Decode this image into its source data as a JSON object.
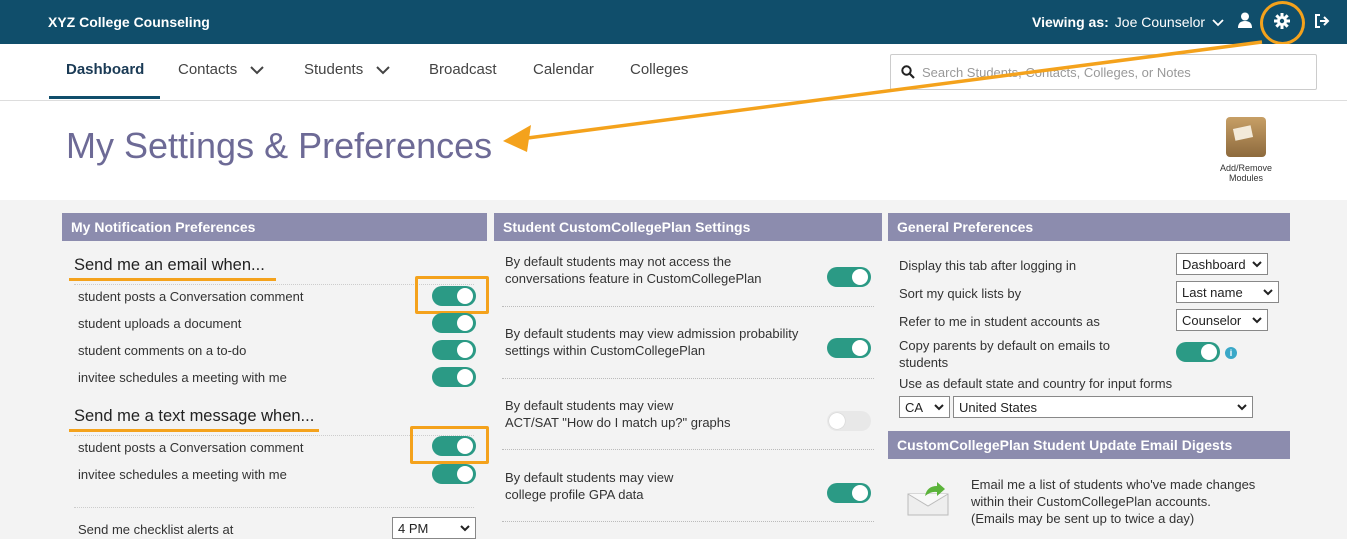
{
  "app": {
    "brand": "XYZ College Counseling"
  },
  "user": {
    "viewing_label": "Viewing as:",
    "name": "Joe Counselor"
  },
  "nav": {
    "tabs": [
      {
        "label": "Dashboard"
      },
      {
        "label": "Contacts"
      },
      {
        "label": "Students"
      },
      {
        "label": "Broadcast"
      },
      {
        "label": "Calendar"
      },
      {
        "label": "Colleges"
      }
    ],
    "search_placeholder": "Search Students, Contacts, Colleges, or Notes"
  },
  "page": {
    "title": "My Settings & Preferences",
    "modules_label_1": "Add/Remove",
    "modules_label_2": "Modules"
  },
  "notifications": {
    "heading": "My Notification Preferences",
    "email_heading": "Send me an email when...",
    "email_items": [
      {
        "label": "student posts a Conversation comment",
        "on": true
      },
      {
        "label": "student uploads a document",
        "on": true
      },
      {
        "label": "student comments on a to-do",
        "on": true
      },
      {
        "label": "invitee schedules a meeting with me",
        "on": true
      }
    ],
    "text_heading": "Send me a text message when...",
    "text_items": [
      {
        "label": "student posts a Conversation comment",
        "on": true
      },
      {
        "label": "invitee schedules a meeting with me",
        "on": true
      }
    ],
    "checklist_label": "Send me checklist alerts at",
    "checklist_value": "4 PM"
  },
  "ccp": {
    "heading": "Student CustomCollegePlan Settings",
    "items": [
      {
        "line1": "By default students may not access the",
        "line2": "conversations feature in CustomCollegePlan",
        "on": true
      },
      {
        "line1": "By default students may view admission probability",
        "line2": "settings within CustomCollegePlan",
        "on": true
      },
      {
        "line1": "By default students may view",
        "line2": "ACT/SAT \"How do I match up?\" graphs",
        "on": false
      },
      {
        "line1": "By default students may view",
        "line2": "college profile GPA data",
        "on": true
      }
    ]
  },
  "general": {
    "heading": "General Preferences",
    "tab_label": "Display this tab after logging in",
    "tab_value": "Dashboard",
    "sort_label": "Sort my quick lists by",
    "sort_value": "Last name",
    "refer_label": "Refer to me in student accounts as",
    "refer_value": "Counselor",
    "copy_line1": "Copy parents by default on emails to",
    "copy_line2": "students",
    "copy_on": true,
    "state_label": "Use as default state and country for input forms",
    "state_value": "CA",
    "country_value": "United States"
  },
  "digest": {
    "heading": "CustomCollegePlan Student Update Email Digests",
    "line1": "Email me a list of students who've made changes",
    "line2": "within their CustomCollegePlan accounts.",
    "line3": "(Emails may be sent up to twice a day)"
  },
  "colors": {
    "header": "#104e6b",
    "accent": "#f4a21c",
    "toggle_on": "#2b9a85",
    "panel": "#8c8cae",
    "title": "#6d6a96"
  },
  "icons": [
    "user-icon",
    "gear-icon",
    "logout-icon",
    "search-icon",
    "chevron-down-icon",
    "info-icon",
    "envelope-icon",
    "modules-icon"
  ]
}
